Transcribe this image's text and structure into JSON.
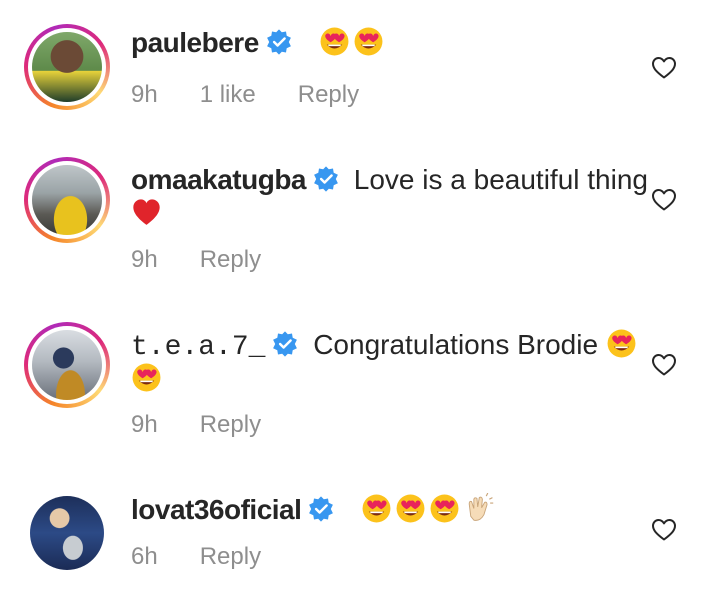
{
  "comments": [
    {
      "username": "paulebere",
      "text": "",
      "emojis": [
        "heart-eyes",
        "heart-eyes"
      ],
      "time": "9h",
      "likes": "1 like",
      "reply": "Reply"
    },
    {
      "username": "omaakatugba",
      "text": "Love is a beautiful thing",
      "emojis": [
        "red-heart"
      ],
      "time": "9h",
      "reply": "Reply"
    },
    {
      "username": "t.e.a.7_",
      "text": "Congratulations Brodie",
      "emojis": [
        "heart-eyes",
        "heart-eyes"
      ],
      "time": "9h",
      "reply": "Reply"
    },
    {
      "username": "lovat36oficial",
      "text": "",
      "emojis": [
        "heart-eyes",
        "heart-eyes",
        "heart-eyes",
        "clapping-hands"
      ],
      "time": "6h",
      "reply": "Reply"
    }
  ],
  "colors": {
    "verified": "#3897f0",
    "meta": "#8e8e8e",
    "text": "#262626"
  }
}
